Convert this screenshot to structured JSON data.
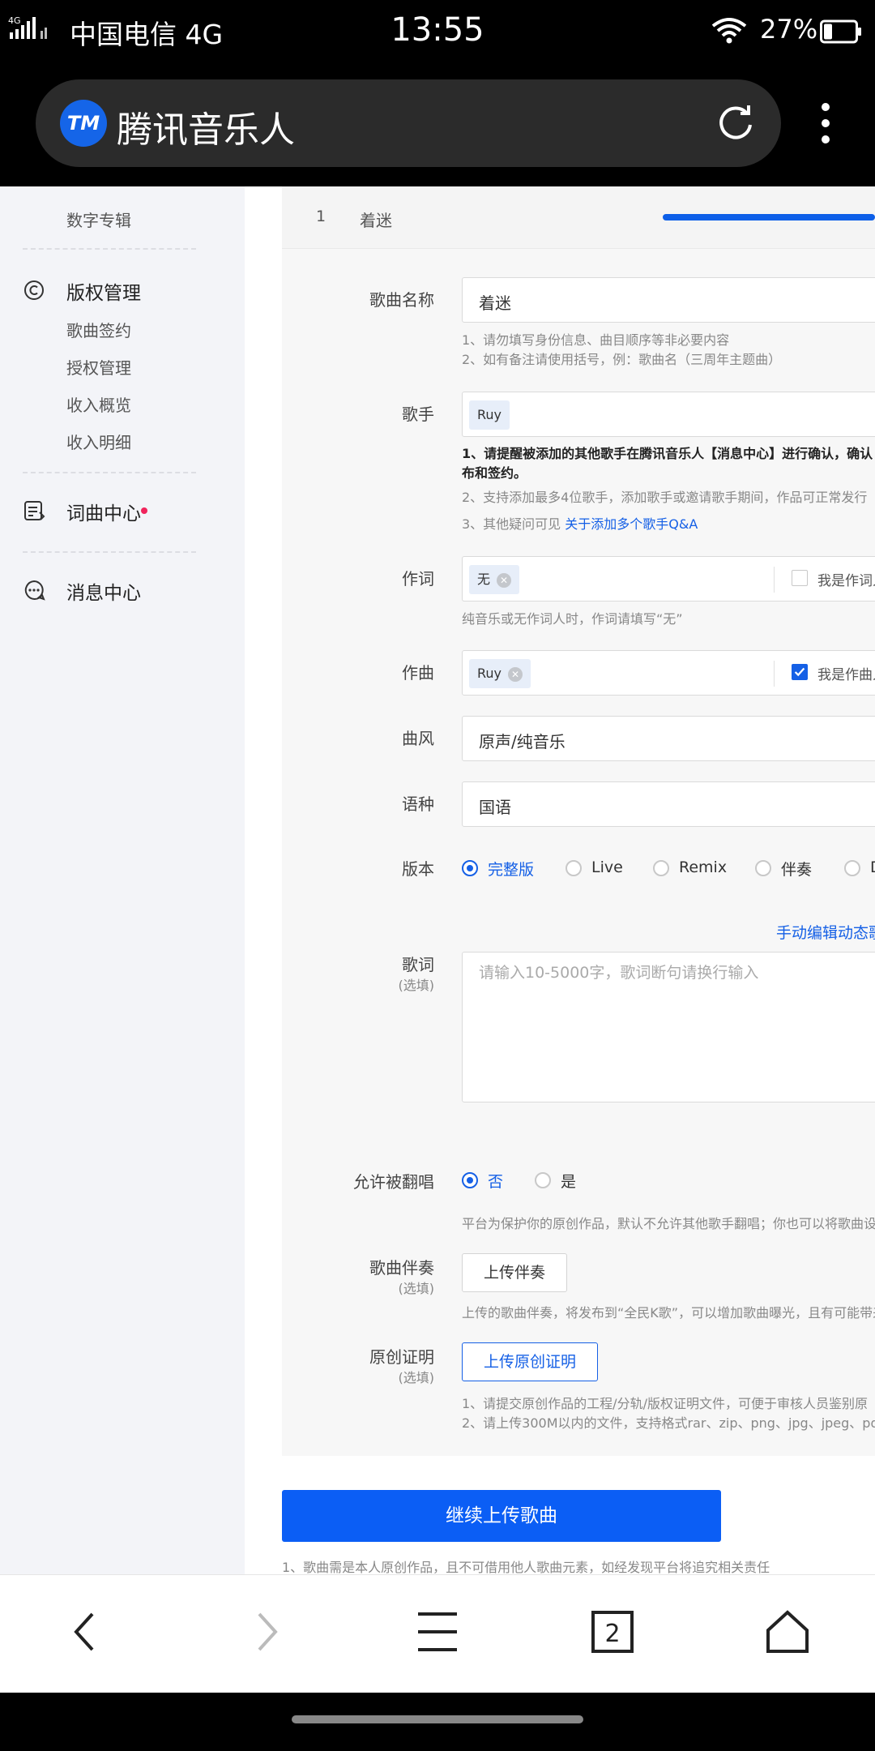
{
  "status_bar": {
    "network_badge": "4G",
    "carrier": "中国电信 4G",
    "time": "13:55",
    "battery_percent": "27%",
    "battery_level": 0.27
  },
  "browser": {
    "logo_text": "TM",
    "title": "腾讯音乐人",
    "tab_count": "2"
  },
  "sidebar": {
    "items": [
      {
        "label": "数字专辑"
      },
      {
        "label": "版权管理"
      },
      {
        "label": "歌曲签约"
      },
      {
        "label": "授权管理"
      },
      {
        "label": "收入概览"
      },
      {
        "label": "收入明细"
      },
      {
        "label": "词曲中心"
      },
      {
        "label": "消息中心"
      }
    ]
  },
  "song_tab": {
    "index": "1",
    "name": "着迷",
    "progress": 1.0
  },
  "form": {
    "song_name": {
      "label": "歌曲名称",
      "value": "着迷",
      "hints": [
        "1、请勿填写身份信息、曲目顺序等非必要内容",
        "2、如有备注请使用括号，例：歌曲名（三周年主题曲）"
      ]
    },
    "singer": {
      "label": "歌手",
      "tag": "Ruy",
      "hint_strong": "1、请提醒被添加的其他歌手在腾讯音乐人【消息中心】进行确认，确认",
      "hint_strong_2": "布和签约。",
      "hint_2": "2、支持添加最多4位歌手，添加歌手或邀请歌手期间，作品可正常发行",
      "hint_3_prefix": "3、其他疑问可见",
      "hint_3_link": "关于添加多个歌手Q&A"
    },
    "lyricist": {
      "label": "作词",
      "tag": "无",
      "checkbox_label": "我是作词人",
      "checked": false,
      "hint": "纯音乐或无作词人时，作词请填写“无”"
    },
    "composer": {
      "label": "作曲",
      "tag": "Ruy",
      "checkbox_label": "我是作曲人",
      "checked": true
    },
    "genre": {
      "label": "曲风",
      "value": "原声/纯音乐"
    },
    "language": {
      "label": "语种",
      "value": "国语"
    },
    "version": {
      "label": "版本",
      "options": [
        {
          "label": "完整版",
          "selected": true
        },
        {
          "label": "Live",
          "selected": false
        },
        {
          "label": "Remix",
          "selected": false
        },
        {
          "label": "伴奏",
          "selected": false
        },
        {
          "label": "D",
          "selected": false
        }
      ]
    },
    "lyrics": {
      "edit_link": "手动编辑动态歌",
      "label": "歌词",
      "optional": "(选填)",
      "placeholder": "请输入10-5000字，歌词断句请换行输入"
    },
    "cover": {
      "label": "允许被翻唱",
      "options": [
        {
          "label": "否",
          "selected": true
        },
        {
          "label": "是",
          "selected": false
        }
      ],
      "hint": "平台为保护你的原创作品，默认不允许其他歌手翻唱；你也可以将歌曲设"
    },
    "accompaniment": {
      "label": "歌曲伴奏",
      "optional": "(选填)",
      "button": "上传伴奏",
      "hint": "上传的歌曲伴奏，将发布到“全民K歌”，可以增加歌曲曝光，且有可能带来"
    },
    "proof": {
      "label": "原创证明",
      "optional": "(选填)",
      "button": "上传原创证明",
      "hints": [
        "1、请提交原创作品的工程/分轨/版权证明文件，可便于审核人员鉴别原",
        "2、请上传300M以内的文件，支持格式rar、zip、png、jpg、jpeg、pdf、"
      ]
    }
  },
  "submit": {
    "label": "继续上传歌曲",
    "footnote": "1、歌曲需是本人原创作品，且不可借用他人歌曲元素，如经发现平台将追究相关责任"
  },
  "bottom_nav": {
    "icons": [
      "back-icon",
      "forward-icon",
      "menu-icon",
      "tabs-icon",
      "home-icon"
    ]
  },
  "colors": {
    "accent": "#1560e6",
    "primary_button": "#0b5ef5",
    "notification_dot": "#f0245c"
  }
}
